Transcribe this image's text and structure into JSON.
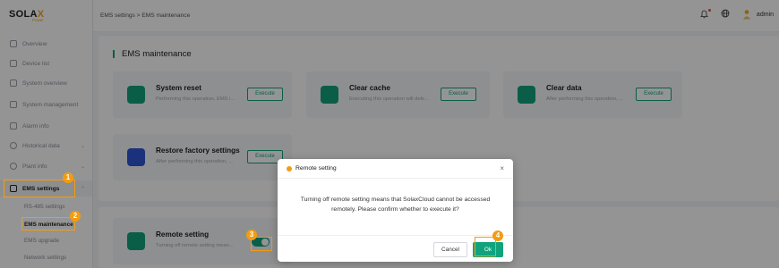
{
  "brand": {
    "logo_main": "SOLA",
    "logo_x": "X",
    "logo_sub": "Power"
  },
  "sidebar": {
    "items": [
      {
        "label": "Overview"
      },
      {
        "label": "Device list"
      },
      {
        "label": "System overview"
      },
      {
        "label": "System management"
      },
      {
        "label": "Alarm info"
      },
      {
        "label": "Historical data"
      },
      {
        "label": "Plant info"
      },
      {
        "label": "EMS settings"
      }
    ],
    "sub_items": [
      {
        "label": "RS-485 settings"
      },
      {
        "label": "EMS maintenance"
      },
      {
        "label": "EMS upgrade"
      },
      {
        "label": "Network settings"
      }
    ]
  },
  "header": {
    "breadcrumb": "EMS settings  >  EMS maintenance",
    "user": "admin"
  },
  "main": {
    "title": "EMS maintenance",
    "cards": [
      {
        "title": "System reset",
        "desc": "Performing this operation, EMS i...",
        "button": "Execute"
      },
      {
        "title": "Clear cache",
        "desc": "Executing this operation will dele...",
        "button": "Execute"
      },
      {
        "title": "Clear data",
        "desc": "After performing this operation, ...",
        "button": "Execute"
      },
      {
        "title": "Restore factory settings",
        "desc": "After performing this operation, ...",
        "button": "Execute"
      }
    ],
    "remote": {
      "title": "Remote setting",
      "desc": "Turning off remote setting mean...",
      "toggle_on": true
    }
  },
  "dialog": {
    "title": "Remote setting",
    "close": "×",
    "message_line1": "Turning off remote setting means that SolaxCloud cannot be accessed",
    "message_line2": "remotely. Please confirm whether to execute it?",
    "cancel": "Cancel",
    "ok": "Ok"
  },
  "callouts": [
    "1",
    "2",
    "3",
    "4"
  ],
  "colors": {
    "accent": "#12a37c",
    "callout": "#f39c12"
  }
}
